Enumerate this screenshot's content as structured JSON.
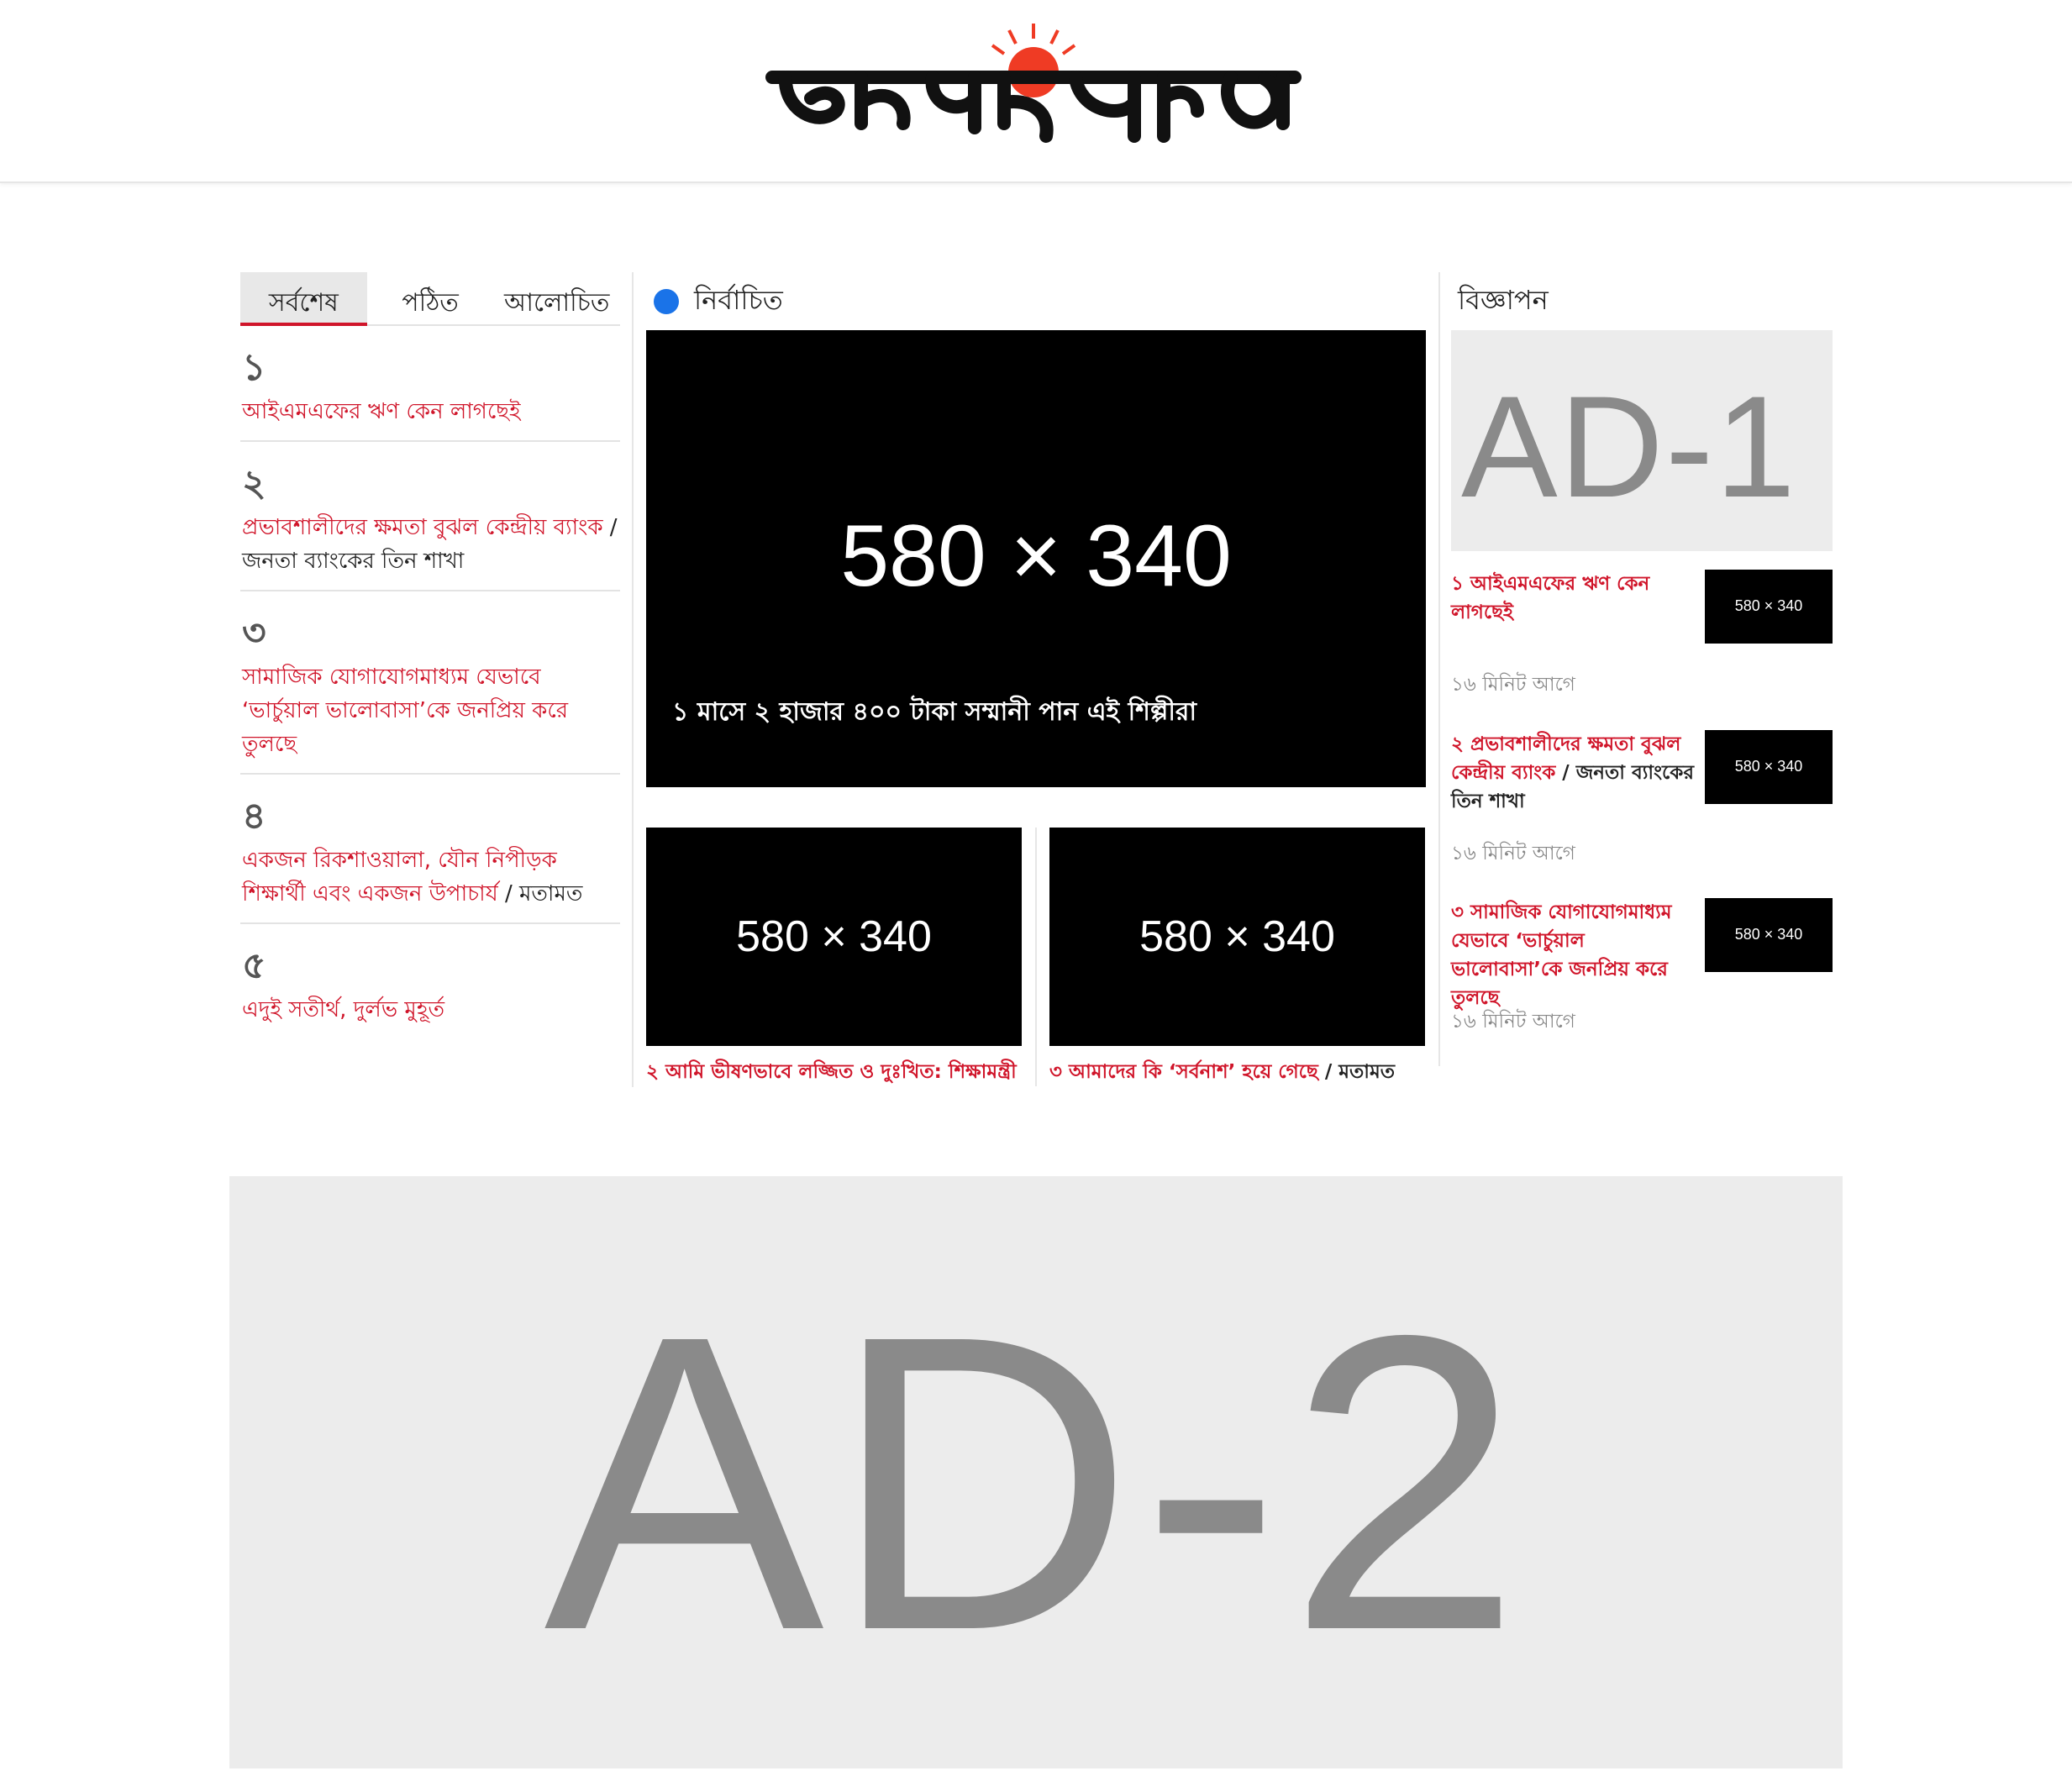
{
  "header": {
    "logo_text": "প্রথম আলো"
  },
  "tabs": [
    {
      "label": "সর্বশেষ"
    },
    {
      "label": "পঠিত"
    },
    {
      "label": "আলোচিত"
    }
  ],
  "ranked_list": [
    {
      "rank": "১",
      "title": "আইএমএফের ঋণ কেন লাগছেই",
      "tag": ""
    },
    {
      "rank": "২",
      "title": "প্রভাবশালীদের ক্ষমতা বুঝল কেন্দ্রীয় ব্যাংক",
      "tag": " / জনতা ব্যাংকের তিন শাখা"
    },
    {
      "rank": "৩",
      "title": "সামাজিক যোগাযোগমাধ্যম যেভাবে ‘ভার্চুয়াল ভালোবাসা’কে জনপ্রিয় করে তুলছে",
      "tag": ""
    },
    {
      "rank": "৪",
      "title": "একজন রিকশাওয়ালা, যৌন নিপীড়ক শিক্ষার্থী এবং একজন উপাচার্য",
      "tag": " / মতামত"
    },
    {
      "rank": "৫",
      "title": "এদুই সতীর্থ, দুর্লভ মুহূর্ত",
      "tag": ""
    }
  ],
  "featured": {
    "heading": "নির্বাচিত",
    "main_image_label": "580 × 340",
    "main_caption": "১ মাসে ২ হাজার ৪০০ টাকা সম্মানী পান এই শিল্পীরা",
    "cards": [
      {
        "image_label": "580 × 340",
        "title": "২ আমি ভীষণভাবে লজ্জিত ও দুঃখিত: শিক্ষামন্ত্রী",
        "tag": ""
      },
      {
        "image_label": "580 × 340",
        "title": "৩ আমাদের কি ‘সর্বনাশ’ হয়ে গেছে",
        "tag": " / মতামত"
      }
    ]
  },
  "sidebar": {
    "heading": "বিজ্ঞাপন",
    "ad_label": "AD-1",
    "items": [
      {
        "title": "১ আইএমএফের ঋণ কেন লাগছেই",
        "tag": "",
        "image_label": "580 × 340",
        "time": "১৬ মিনিট আগে"
      },
      {
        "title": "২ প্রভাবশালীদের ক্ষমতা বুঝল কেন্দ্রীয় ব্যাংক",
        "tag": " / জনতা ব্যাংকের তিন শাখা",
        "image_label": "580 × 340",
        "time": "১৬ মিনিট আগে"
      },
      {
        "title": "৩ সামাজিক যোগাযোগমাধ্যম যেভাবে ‘ভার্চুয়াল ভালোবাসা’কে জনপ্রিয় করে তুলছে",
        "tag": "",
        "image_label": "580 × 340",
        "time": "১৬ মিনিট আগে"
      }
    ]
  },
  "bottom_ad": {
    "label": "AD-2"
  },
  "colors": {
    "accent_red": "#d0152a",
    "logo_sun": "#ef3b24",
    "dot_blue": "#1a73e8",
    "ad_bg": "#ececec"
  }
}
